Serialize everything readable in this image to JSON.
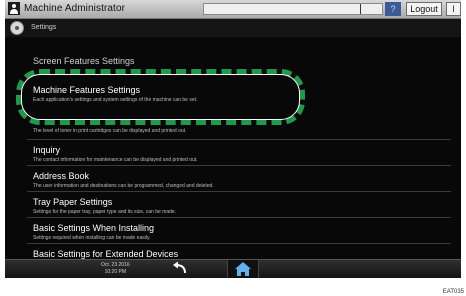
{
  "title_bar": {
    "title": "Machine Administrator",
    "help_label": "?",
    "logout_label": "Logout",
    "extra_label": "l"
  },
  "header": {
    "label": "Settings"
  },
  "menu": {
    "items": [
      {
        "title": "Screen Features Settings",
        "desc": ""
      },
      {
        "title": "Machine Features Settings",
        "desc": "Each application's settings and system settings of the machine can be set."
      },
      {
        "title": "",
        "desc": "The level of toner in print cartridges can be displayed and printed out."
      },
      {
        "title": "Inquiry",
        "desc": "The contact information for maintenance can be displayed and printed out."
      },
      {
        "title": "Address Book",
        "desc": "The user information and destinations can be programmed, changed and deleted."
      },
      {
        "title": "Tray Paper Settings",
        "desc": "Settings for the paper tray, paper type and its size, can be made."
      },
      {
        "title": "Basic Settings When Installing",
        "desc": "Settings required when installing can be made easily."
      },
      {
        "title": "Basic Settings for Extended Devices",
        "desc": ""
      }
    ]
  },
  "bottom_bar": {
    "date": "Oct. 23 2016",
    "time": "10:20 PM"
  },
  "footer": {
    "code": "EAT035"
  },
  "colors": {
    "highlight": "#1f9a48",
    "help_button": "#3d5a98"
  },
  "icons": [
    "user-icon",
    "gear-icon",
    "back-icon",
    "home-icon"
  ]
}
